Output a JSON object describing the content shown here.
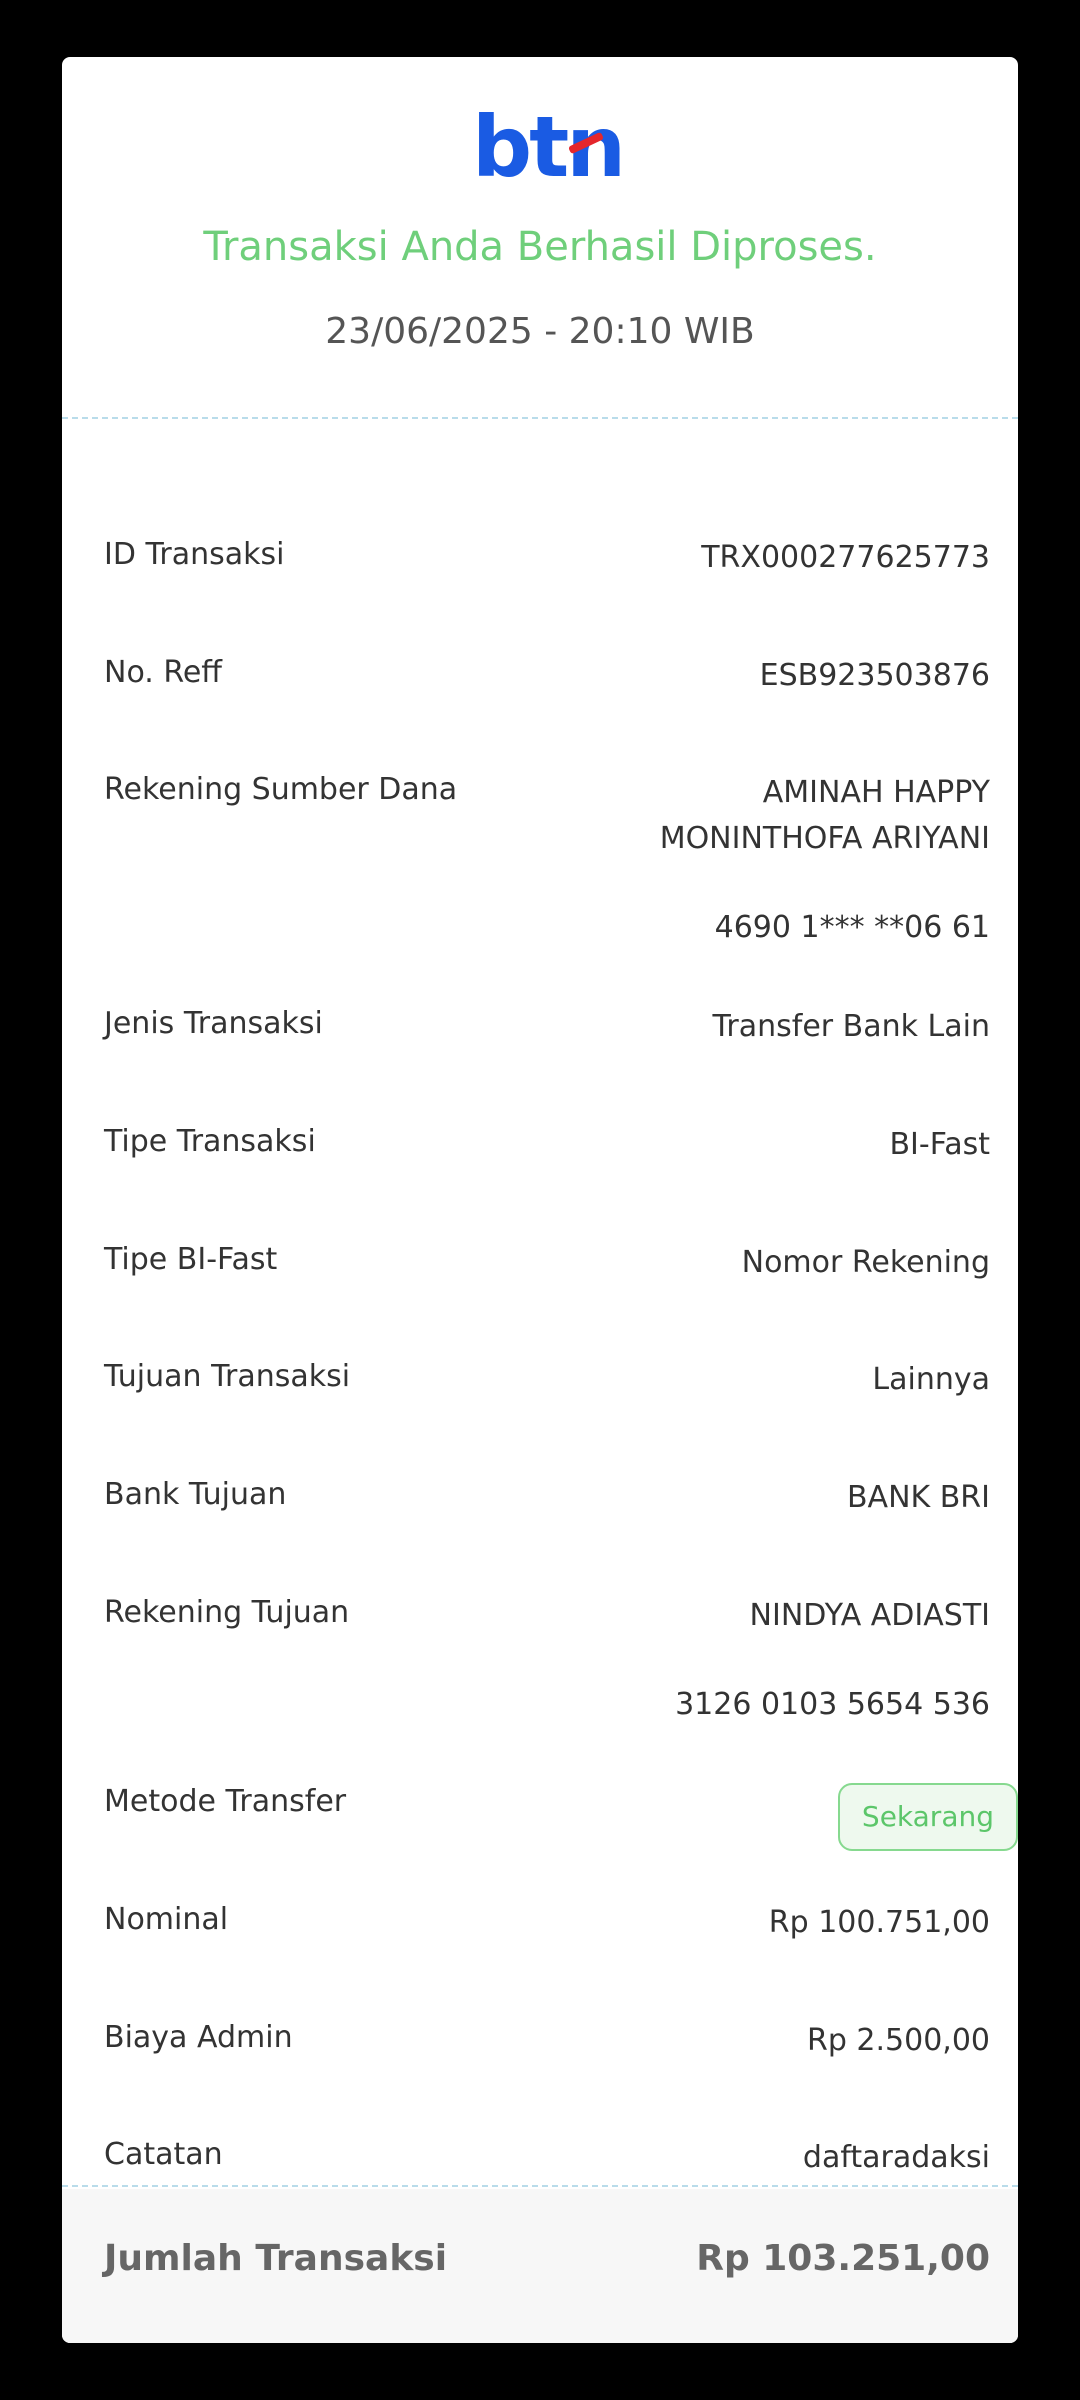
{
  "header": {
    "logo_text": "btn",
    "status_title": "Transaksi Anda Berhasil Diproses.",
    "datetime": "23/06/2025 - 20:10 WIB"
  },
  "details": {
    "id_transaksi": {
      "label": "ID Transaksi",
      "value": "TRX000277625773"
    },
    "no_reff": {
      "label": "No. Reff",
      "value": "ESB923503876"
    },
    "rekening_sumber": {
      "label": "Rekening Sumber Dana",
      "name_line1": "AMINAH HAPPY",
      "name_line2": "MONINTHOFA ARIYANI",
      "account": "4690 1*** **06 61"
    },
    "jenis_transaksi": {
      "label": "Jenis Transaksi",
      "value": "Transfer Bank Lain"
    },
    "tipe_transaksi": {
      "label": "Tipe Transaksi",
      "value": "BI-Fast"
    },
    "tipe_bifast": {
      "label": "Tipe BI-Fast",
      "value": "Nomor Rekening"
    },
    "tujuan_transaksi": {
      "label": "Tujuan Transaksi",
      "value": "Lainnya"
    },
    "bank_tujuan": {
      "label": "Bank Tujuan",
      "value": "BANK BRI"
    },
    "rekening_tujuan": {
      "label": "Rekening Tujuan",
      "name": "NINDYA ADIASTI",
      "account": "3126 0103 5654 536"
    },
    "metode_transfer": {
      "label": "Metode Transfer",
      "value": "Sekarang"
    },
    "nominal": {
      "label": "Nominal",
      "value": "Rp 100.751,00"
    },
    "biaya_admin": {
      "label": "Biaya Admin",
      "value": "Rp 2.500,00"
    },
    "catatan": {
      "label": "Catatan",
      "value": "daftaradaksi"
    }
  },
  "total": {
    "label": "Jumlah Transaksi",
    "value": "Rp 103.251,00"
  },
  "colors": {
    "brand_blue": "#1a5be3",
    "brand_red": "#e4262c",
    "success_green": "#6fcf7b",
    "divider": "#b9dcea"
  }
}
